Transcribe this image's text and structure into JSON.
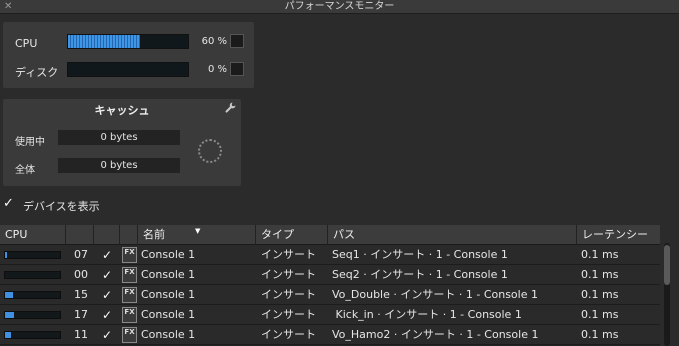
{
  "window": {
    "title": "パフォーマンスモニター",
    "close_glyph": "✕"
  },
  "performance": {
    "cpu": {
      "label": "CPU",
      "percent_text": "60 %",
      "level": 0.6
    },
    "disk": {
      "label": "ディスク",
      "percent_text": "0 %",
      "level": 0.0
    }
  },
  "cache": {
    "title": "キャッシュ",
    "in_use_label": "使用中",
    "in_use_value": "0 bytes",
    "total_label": "全体",
    "total_value": "0 bytes"
  },
  "show_devices": {
    "label": "デバイスを表示",
    "checked": true
  },
  "table": {
    "headers": {
      "cpu": "CPU",
      "name": "名前",
      "type": "タイプ",
      "path": "パス",
      "latency": "レーテンシー"
    },
    "fx_label": "FX",
    "rows": [
      {
        "cpu_level": 0.04,
        "num": "07",
        "name": "Console 1",
        "type": "インサート",
        "path": "Seq1 · インサート · 1 - Console 1",
        "latency": "0.1 ms"
      },
      {
        "cpu_level": 0.0,
        "num": "00",
        "name": "Console 1",
        "type": "インサート",
        "path": "Seq2 · インサート · 1 - Console 1",
        "latency": "0.1 ms"
      },
      {
        "cpu_level": 0.15,
        "num": "15",
        "name": "Console 1",
        "type": "インサート",
        "path": "Vo_Double · インサート · 1 - Console 1",
        "latency": "0.1 ms"
      },
      {
        "cpu_level": 0.17,
        "num": "17",
        "name": "Console 1",
        "type": "インサート",
        "path": " Kick_in · インサート · 1 - Console 1",
        "latency": "0.1 ms"
      },
      {
        "cpu_level": 0.11,
        "num": "11",
        "name": "Console 1",
        "type": "インサート",
        "path": "Vo_Hamo2 · インサート · 1 - Console 1",
        "latency": "0.1 ms"
      }
    ]
  },
  "colors": {
    "accent_blue": "#3f96e4",
    "background": "#2b2b2b",
    "panel": "#3a3a3a"
  }
}
